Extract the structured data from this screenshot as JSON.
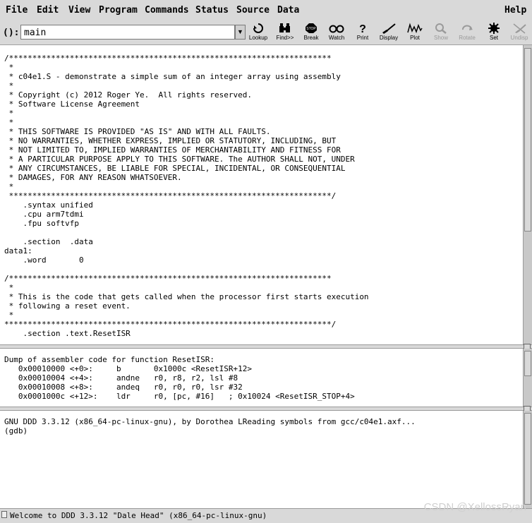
{
  "menubar": {
    "items": [
      "File",
      "Edit",
      "View",
      "Program",
      "Commands",
      "Status",
      "Source",
      "Data"
    ],
    "help": "Help"
  },
  "toolbar": {
    "arg_label": "():",
    "arg_value": "main",
    "buttons": [
      {
        "label": "Lookup",
        "icon": "lookup-icon",
        "enabled": true
      },
      {
        "label": "Find>>",
        "icon": "find-icon",
        "enabled": true
      },
      {
        "label": "Break",
        "icon": "stop-sign-icon",
        "enabled": true
      },
      {
        "label": "Watch",
        "icon": "watch-glasses-icon",
        "enabled": true
      },
      {
        "label": "Print",
        "icon": "question-mark-icon",
        "enabled": true
      },
      {
        "label": "Display",
        "icon": "display-brush-icon",
        "enabled": true
      },
      {
        "label": "Plot",
        "icon": "plot-wave-icon",
        "enabled": true
      },
      {
        "label": "Show",
        "icon": "show-magnifier-icon",
        "enabled": false
      },
      {
        "label": "Rotate",
        "icon": "rotate-icon",
        "enabled": false
      },
      {
        "label": "Set",
        "icon": "set-gear-icon",
        "enabled": true
      },
      {
        "label": "Undisp",
        "icon": "undisplay-icon",
        "enabled": false
      }
    ]
  },
  "source": {
    "lines": [
      "/*********************************************************************",
      " *",
      " * c04e1.S - demonstrate a simple sum of an integer array using assembly",
      " *",
      " * Copyright (c) 2012 Roger Ye.  All rights reserved.",
      " * Software License Agreement",
      " *",
      " *",
      " * THIS SOFTWARE IS PROVIDED \"AS IS\" AND WITH ALL FAULTS.",
      " * NO WARRANTIES, WHETHER EXPRESS, IMPLIED OR STATUTORY, INCLUDING, BUT",
      " * NOT LIMITED TO, IMPLIED WARRANTIES OF MERCHANTABILITY AND FITNESS FOR",
      " * A PARTICULAR PURPOSE APPLY TO THIS SOFTWARE. The AUTHOR SHALL NOT, UNDER",
      " * ANY CIRCUMSTANCES, BE LIABLE FOR SPECIAL, INCIDENTAL, OR CONSEQUENTIAL",
      " * DAMAGES, FOR ANY REASON WHATSOEVER.",
      " *",
      " *********************************************************************/",
      "    .syntax unified",
      "    .cpu arm7tdmi",
      "    .fpu softvfp",
      "",
      "    .section  .data",
      "data1:",
      "    .word       0",
      "",
      "/*********************************************************************",
      " *",
      " * This is the code that gets called when the processor first starts execution",
      " * following a reset event.",
      " *",
      "**********************************************************************/",
      "    .section .text.ResetISR"
    ]
  },
  "asm": {
    "lines": [
      "Dump of assembler code for function ResetISR:",
      "   0x00010000 <+0>:     b       0x1000c <ResetISR+12>",
      "   0x00010004 <+4>:     andne   r0, r8, r2, lsl #8",
      "   0x00010008 <+8>:     andeq   r0, r0, r0, lsr #32",
      "   0x0001000c <+12>:    ldr     r0, [pc, #16]   ; 0x10024 <ResetISR_STOP+4>"
    ]
  },
  "console": {
    "lines": [
      "GNU DDD 3.3.12 (x86_64-pc-linux-gnu), by Dorothea LReading symbols from gcc/c04e1.axf...",
      "(gdb) "
    ]
  },
  "status": "Welcome to DDD 3.3.12 \"Dale Head\" (x86_64-pc-linux-gnu)",
  "watermark": "CSDN @XellossRyan"
}
